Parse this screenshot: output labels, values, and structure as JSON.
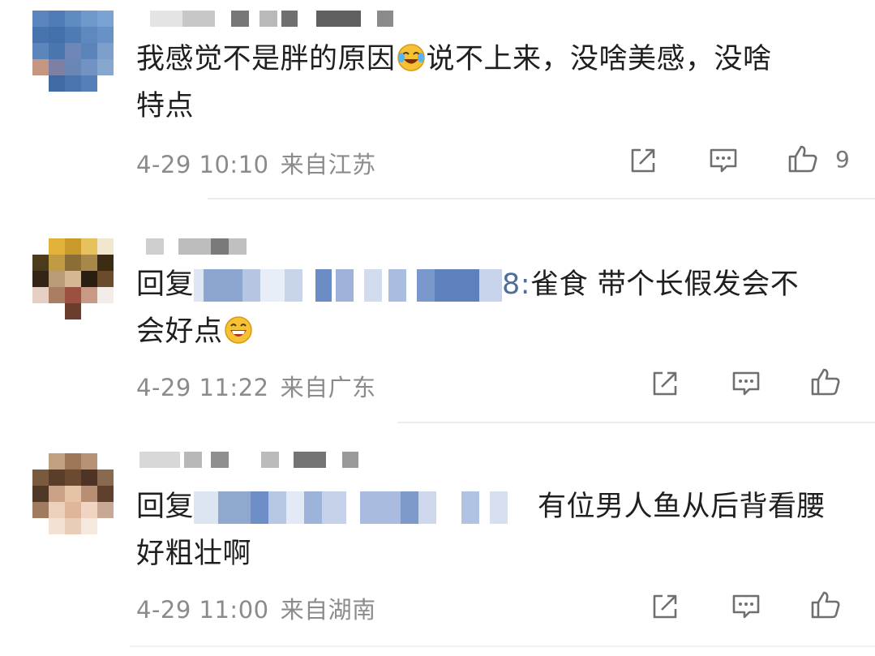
{
  "comments": [
    {
      "text_parts": [
        "我感觉不是胖的原因",
        "说不上来，没啥美感，没啥",
        "特点"
      ],
      "date": "4-29 10:10",
      "location": "来自江苏",
      "like_count": "9"
    },
    {
      "reply_prefix": "回复",
      "reply_id_tail": "8:",
      "text_parts": [
        "雀食 带个长假发会不",
        "会好点"
      ],
      "date": "4-29 11:22",
      "location": "来自广东"
    },
    {
      "reply_prefix": "回复",
      "text_parts": [
        "有位男人鱼从后背看腰",
        "好粗壮啊"
      ],
      "date": "4-29 11:00",
      "location": "来自湖南"
    }
  ],
  "icons": {
    "share": "share-icon",
    "comment": "comment-icon",
    "like": "thumbs-up-icon",
    "emoji_1": "laughing-crying-emoji",
    "emoji_2": "laughing-emoji"
  },
  "colors": {
    "text": "#1f1f1f",
    "meta": "#8b8b8b",
    "mention": "#4e6e9c",
    "divider": "#ececec"
  }
}
